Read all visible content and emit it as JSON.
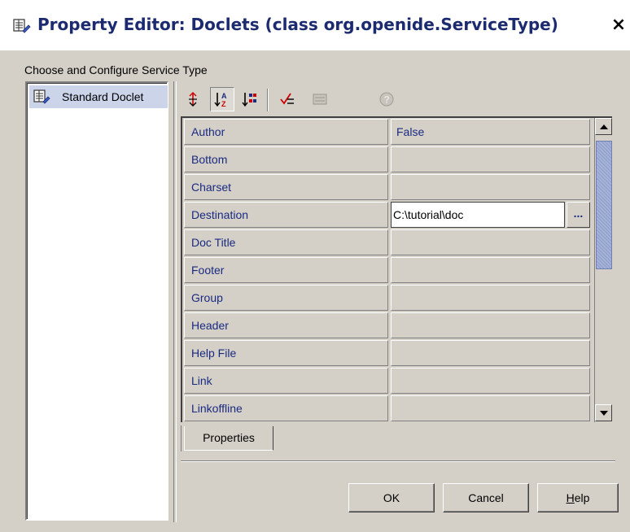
{
  "window": {
    "title": "Property Editor: Doclets (class org.openide.ServiceType)",
    "close_glyph": "×"
  },
  "section_label": "Choose and Configure Service Type",
  "service_list": [
    {
      "label": "Standard Doclet",
      "icon": "doclet-icon",
      "selected": true
    }
  ],
  "toolbar": [
    {
      "name": "unsorted-icon",
      "glyph": "↕"
    },
    {
      "name": "sort-by-name-icon",
      "glyph": "AZ"
    },
    {
      "name": "sort-by-type-icon",
      "glyph": "T"
    },
    {
      "name": "show-editable-only-icon",
      "glyph": "✓"
    },
    {
      "name": "customize-icon",
      "glyph": "▦"
    },
    {
      "name": "help-icon",
      "glyph": "?"
    }
  ],
  "properties": [
    {
      "name": "Author",
      "value": "False"
    },
    {
      "name": "Bottom",
      "value": ""
    },
    {
      "name": "Charset",
      "value": ""
    },
    {
      "name": "Destination",
      "value": "C:\\tutorial\\doc",
      "editing": true
    },
    {
      "name": "Doc Title",
      "value": ""
    },
    {
      "name": "Footer",
      "value": ""
    },
    {
      "name": "Group",
      "value": ""
    },
    {
      "name": "Header",
      "value": ""
    },
    {
      "name": "Help File",
      "value": ""
    },
    {
      "name": "Link",
      "value": ""
    },
    {
      "name": "Linkoffline",
      "value": ""
    }
  ],
  "ellipsis_label": "...",
  "tab_label": "Properties",
  "buttons": {
    "ok": "OK",
    "cancel": "Cancel",
    "help": "Help",
    "help_mnemonic": "H"
  },
  "colors": {
    "title_text": "#1c2a6f",
    "property_text": "#1a2a80",
    "selection": "#ccd4ea",
    "scroll_thumb": "#a7b3d6"
  }
}
